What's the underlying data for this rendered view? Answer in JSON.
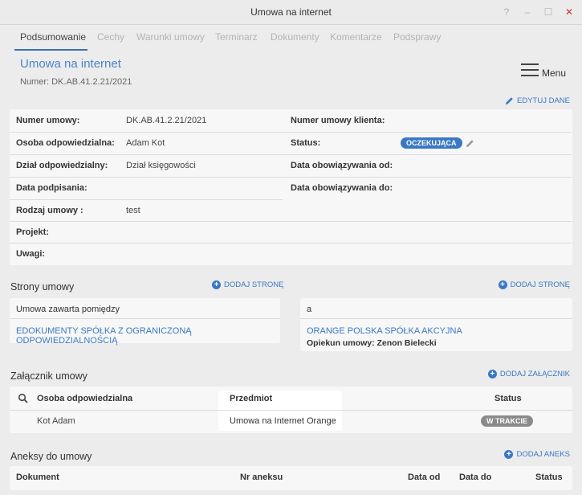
{
  "window": {
    "title": "Umowa na internet",
    "controls": {
      "help": "?",
      "minimize": "–",
      "maximize": "☐",
      "close": "✕"
    }
  },
  "tabs": [
    "Podsumowanie",
    "Cechy",
    "Warunki umowy",
    "Terminarz",
    "Dokumenty",
    "Komentarze",
    "Podsprawy"
  ],
  "active_tab": "Podsumowanie",
  "header": {
    "title": "Umowa na internet",
    "number": "Numer: DK.AB.41.2.21/2021",
    "menu_label": "Menu",
    "edit_label": "EDYTUJ DANE"
  },
  "details": {
    "contract_number_label": "Numer umowy:",
    "contract_number_value": "DK.AB.41.2.21/2021",
    "client_number_label": "Numer umowy klienta:",
    "responsible_label": "Osoba odpowiedzialna:",
    "responsible_value": "Adam Kot",
    "status_label": "Status:",
    "status_value": "OCZEKUJĄCA",
    "department_label": "Dział odpowiedzialny:",
    "department_value": "Dział księgowości",
    "valid_from_label": "Data obowiązywania od:",
    "signing_label": "Data podpisania:",
    "valid_to_label": "Data obowiązywania do:",
    "type_label": "Rodzaj umowy :",
    "type_value": "test",
    "project_label": "Projekt:",
    "notes_label": "Uwagi:"
  },
  "parties": {
    "title": "Strony umowy",
    "add_left": "DODAJ STRONĘ",
    "add_right": "DODAJ STRONĘ",
    "left_header": "Umowa zawarta pomiędzy",
    "left_company": "EDOKUMENTY SPÓŁKA Z OGRANICZONĄ ODPOWIEDZIALNOŚCIĄ",
    "right_header": "a",
    "right_company": "ORANGE POLSKA SPÓŁKA AKCYJNA",
    "right_keeper": "Opiekun umowy: Zenon Bielecki"
  },
  "attachments": {
    "title": "Załącznik umowy",
    "add_label": "DODAJ ZAŁĄCZNIK",
    "columns": [
      "Osoba odpowiedzialna",
      "Przedmiot",
      "Status"
    ],
    "rows": [
      {
        "person": "Kot Adam",
        "subject": "Umowa na Internet Orange",
        "status": "W TRAKCIE"
      }
    ]
  },
  "annexes": {
    "title": "Aneksy do umowy",
    "add_label": "DODAJ ANEKS",
    "columns": [
      "Dokument",
      "Nr aneksu",
      "Data od",
      "Data do",
      "Status"
    ]
  },
  "colors": {
    "accent": "#3a78c3",
    "title_blue": "#4a85c8",
    "close_red": "#c03a2b",
    "badge_gray": "#8a8a8a"
  }
}
